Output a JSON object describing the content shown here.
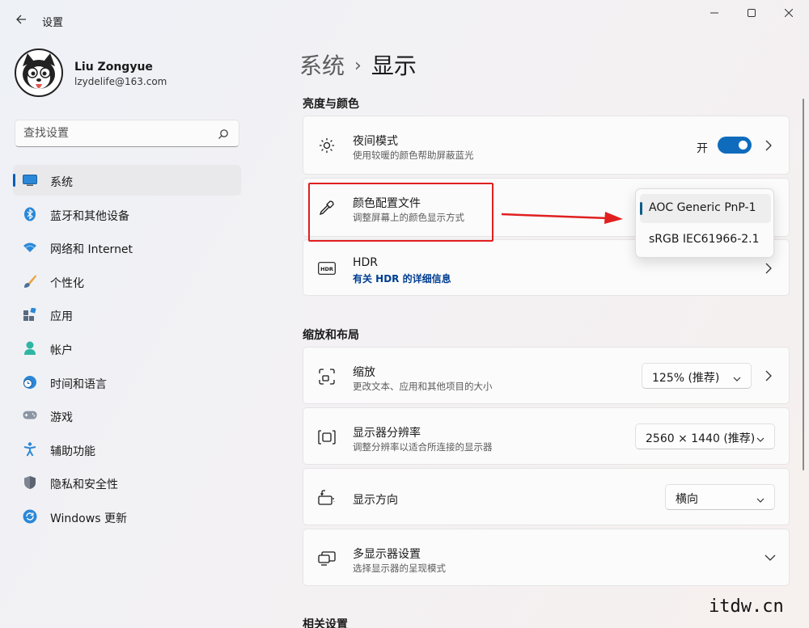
{
  "window": {
    "title": "设置"
  },
  "profile": {
    "name": "Liu Zongyue",
    "email": "lzydelife@163.com"
  },
  "search": {
    "placeholder": "查找设置"
  },
  "sidebar": {
    "items": [
      {
        "label": "系统",
        "icon": "system-icon",
        "active": true
      },
      {
        "label": "蓝牙和其他设备",
        "icon": "bluetooth-icon"
      },
      {
        "label": "网络和 Internet",
        "icon": "wifi-icon"
      },
      {
        "label": "个性化",
        "icon": "brush-icon"
      },
      {
        "label": "应用",
        "icon": "apps-icon"
      },
      {
        "label": "帐户",
        "icon": "account-icon"
      },
      {
        "label": "时间和语言",
        "icon": "clock-globe-icon"
      },
      {
        "label": "游戏",
        "icon": "gamepad-icon"
      },
      {
        "label": "辅助功能",
        "icon": "accessibility-icon"
      },
      {
        "label": "隐私和安全性",
        "icon": "shield-icon"
      },
      {
        "label": "Windows 更新",
        "icon": "update-icon"
      }
    ]
  },
  "breadcrumb": {
    "parent": "系统",
    "separator": "›",
    "current": "显示"
  },
  "sections": {
    "brightness": "亮度与颜色",
    "scale": "缩放和布局",
    "related": "相关设置"
  },
  "cards": {
    "night_light": {
      "title": "夜间模式",
      "subtitle": "使用较暖的颜色帮助屏蔽蓝光",
      "toggle_label": "开",
      "toggle_on": true
    },
    "color_profile": {
      "title": "颜色配置文件",
      "subtitle": "调整屏幕上的颜色显示方式"
    },
    "hdr": {
      "title": "HDR",
      "link": "有关 HDR 的详细信息"
    },
    "scale": {
      "title": "缩放",
      "subtitle": "更改文本、应用和其他项目的大小",
      "value": "125% (推荐)"
    },
    "resolution": {
      "title": "显示器分辨率",
      "subtitle": "调整分辨率以适合所连接的显示器",
      "value": "2560 × 1440 (推荐)"
    },
    "orientation": {
      "title": "显示方向",
      "value": "横向"
    },
    "multi_display": {
      "title": "多显示器设置",
      "subtitle": "选择显示器的呈现模式"
    }
  },
  "color_profile_menu": {
    "options": [
      "AOC Generic PnP-1",
      "sRGB IEC61966-2.1"
    ],
    "selected": "AOC Generic PnP-1"
  },
  "watermark": "itdw.cn",
  "colors": {
    "accent": "#0f6cbd",
    "annotation": "#e02020",
    "link": "#003e92"
  }
}
